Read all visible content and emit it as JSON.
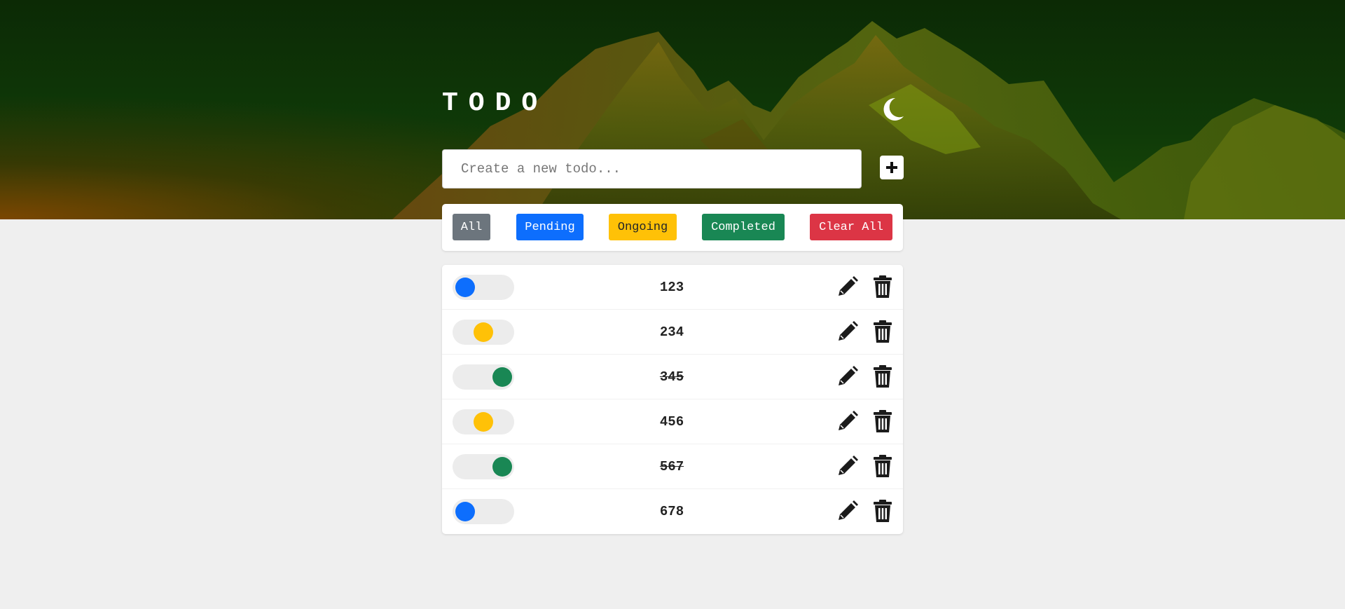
{
  "header": {
    "title": "TODO",
    "theme_icon": "moon-icon"
  },
  "input": {
    "placeholder": "Create a new todo...",
    "value": "",
    "add_icon": "plus-icon"
  },
  "filters": [
    {
      "label": "All",
      "color": "#6c757d",
      "text_color": "#ffffff"
    },
    {
      "label": "Pending",
      "color": "#0d6efd",
      "text_color": "#ffffff"
    },
    {
      "label": "Ongoing",
      "color": "#ffc107",
      "text_color": "#212529"
    },
    {
      "label": "Completed",
      "color": "#198754",
      "text_color": "#ffffff"
    },
    {
      "label": "Clear All",
      "color": "#dc3545",
      "text_color": "#ffffff"
    }
  ],
  "status_colors": {
    "pending": "#0d6efd",
    "ongoing": "#ffc107",
    "completed": "#198754"
  },
  "todos": [
    {
      "text": "123",
      "status": "pending"
    },
    {
      "text": "234",
      "status": "ongoing"
    },
    {
      "text": "345",
      "status": "completed"
    },
    {
      "text": "456",
      "status": "ongoing"
    },
    {
      "text": "567",
      "status": "completed"
    },
    {
      "text": "678",
      "status": "pending"
    }
  ],
  "row_icons": {
    "edit": "pencil-icon",
    "delete": "trash-icon"
  }
}
